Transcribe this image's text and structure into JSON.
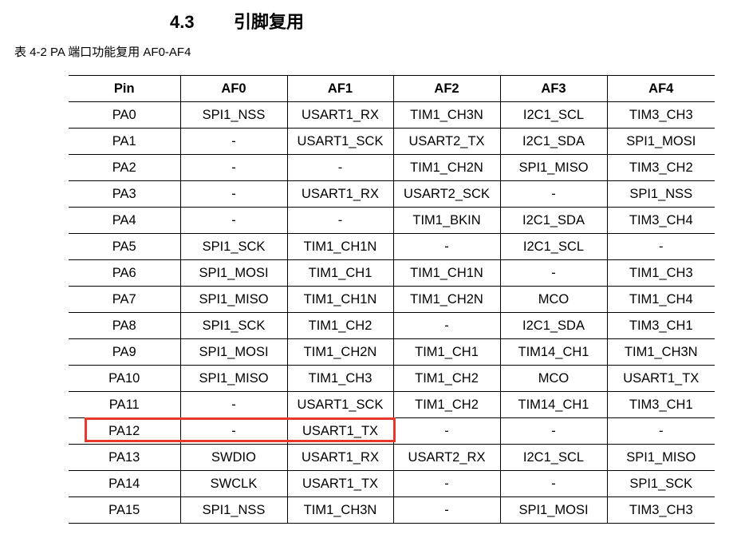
{
  "section": {
    "number": "4.3",
    "title": "引脚复用"
  },
  "caption": "表 4-2 PA 端口功能复用 AF0-AF4",
  "table": {
    "headers": [
      "Pin",
      "AF0",
      "AF1",
      "AF2",
      "AF3",
      "AF4"
    ],
    "rows": [
      [
        "PA0",
        "SPI1_NSS",
        "USART1_RX",
        "TIM1_CH3N",
        "I2C1_SCL",
        "TIM3_CH3"
      ],
      [
        "PA1",
        "-",
        "USART1_SCK",
        "USART2_TX",
        "I2C1_SDA",
        "SPI1_MOSI"
      ],
      [
        "PA2",
        "-",
        "-",
        "TIM1_CH2N",
        "SPI1_MISO",
        "TIM3_CH2"
      ],
      [
        "PA3",
        "-",
        "USART1_RX",
        "USART2_SCK",
        "-",
        "SPI1_NSS"
      ],
      [
        "PA4",
        "-",
        "-",
        "TIM1_BKIN",
        "I2C1_SDA",
        "TIM3_CH4"
      ],
      [
        "PA5",
        "SPI1_SCK",
        "TIM1_CH1N",
        "-",
        "I2C1_SCL",
        "-"
      ],
      [
        "PA6",
        "SPI1_MOSI",
        "TIM1_CH1",
        "TIM1_CH1N",
        "-",
        "TIM1_CH3"
      ],
      [
        "PA7",
        "SPI1_MISO",
        "TIM1_CH1N",
        "TIM1_CH2N",
        "MCO",
        "TIM1_CH4"
      ],
      [
        "PA8",
        "SPI1_SCK",
        "TIM1_CH2",
        "-",
        "I2C1_SDA",
        "TIM3_CH1"
      ],
      [
        "PA9",
        "SPI1_MOSI",
        "TIM1_CH2N",
        "TIM1_CH1",
        "TIM14_CH1",
        "TIM1_CH3N"
      ],
      [
        "PA10",
        "SPI1_MISO",
        "TIM1_CH3",
        "TIM1_CH2",
        "MCO",
        "USART1_TX"
      ],
      [
        "PA11",
        "-",
        "USART1_SCK",
        "TIM1_CH2",
        "TIM14_CH1",
        "TIM3_CH1"
      ],
      [
        "PA12",
        "-",
        "USART1_TX",
        "-",
        "-",
        "-"
      ],
      [
        "PA13",
        "SWDIO",
        "USART1_RX",
        "USART2_RX",
        "I2C1_SCL",
        "SPI1_MISO"
      ],
      [
        "PA14",
        "SWCLK",
        "USART1_TX",
        "-",
        "-",
        "SPI1_SCK"
      ],
      [
        "PA15",
        "SPI1_NSS",
        "TIM1_CH3N",
        "-",
        "SPI1_MOSI",
        "TIM3_CH3"
      ]
    ]
  },
  "annotation": {
    "highlight_color": "#e8382c",
    "highlighted_row_pin": "PA12",
    "highlighted_columns": [
      "Pin",
      "AF0",
      "AF1"
    ]
  }
}
